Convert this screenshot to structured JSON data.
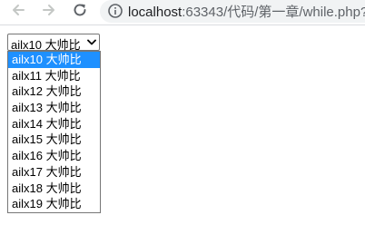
{
  "browser": {
    "url_host": "localhost",
    "url_path": ":63343/代码/第一章/while.php?",
    "icons": [
      "back-arrow-icon",
      "forward-arrow-icon",
      "reload-icon",
      "info-icon"
    ]
  },
  "select": {
    "value": "ailx10 大帅比",
    "options": [
      "ailx10 大帅比",
      "ailx11 大帅比",
      "ailx12 大帅比",
      "ailx13 大帅比",
      "ailx14 大帅比",
      "ailx15 大帅比",
      "ailx16 大帅比",
      "ailx17 大帅比",
      "ailx18 大帅比",
      "ailx19 大帅比"
    ],
    "highlighted_index": 0,
    "highlight_color": "#1e90ff"
  }
}
